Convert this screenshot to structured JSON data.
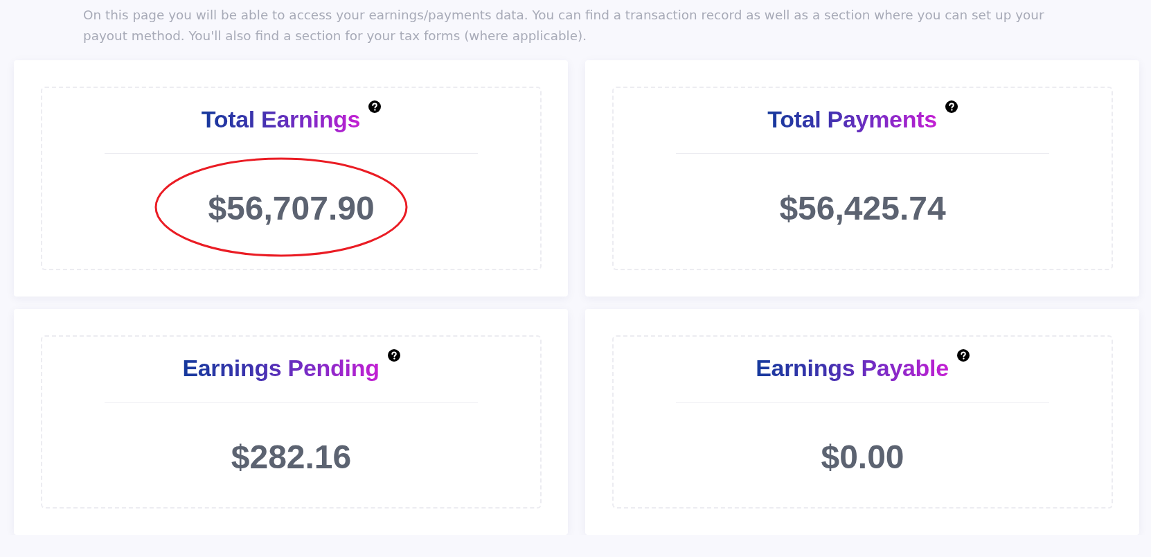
{
  "intro": "On this page you will be able to access your earnings/payments data. You can find a transaction record as well as a section where you can set up your payout method. You'll also find a section for your tax forms (where applicable).",
  "cards": [
    {
      "title": "Total Earnings",
      "amount": "$56,707.90",
      "highlighted": true
    },
    {
      "title": "Total Payments",
      "amount": "$56,425.74",
      "highlighted": false
    },
    {
      "title": "Earnings Pending",
      "amount": "$282.16",
      "highlighted": false
    },
    {
      "title": "Earnings Payable",
      "amount": "$0.00",
      "highlighted": false
    }
  ]
}
